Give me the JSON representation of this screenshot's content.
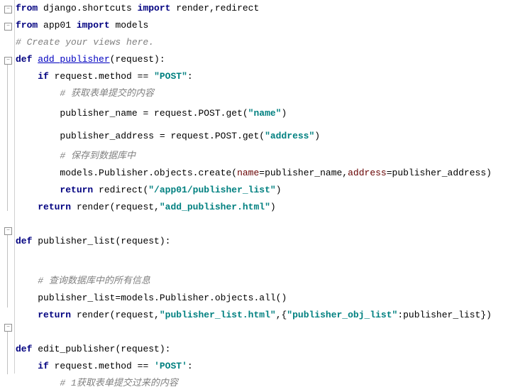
{
  "code": {
    "l1": {
      "kw1": "from",
      "mod1": " django.shortcuts ",
      "kw2": "import",
      "rest": " render,redirect"
    },
    "l2": {
      "kw1": "from",
      "mod1": " app01 ",
      "kw2": "import",
      "rest": " models"
    },
    "l3": {
      "comment": "# Create your views here."
    },
    "l4": {
      "kw1": "def",
      "sp": " ",
      "fn": "add_publisher",
      "rest": "(request):"
    },
    "l5": {
      "indent": "    ",
      "kw1": "if",
      "rest": " request.method == ",
      "str": "\"POST\"",
      "colon": ":"
    },
    "l6": {
      "indent": "        ",
      "comment": "# 获取表单提交的内容"
    },
    "l7": {
      "indent": "        ",
      "a": "publisher_name = request.POST.get(",
      "str": "\"name\"",
      "b": ")"
    },
    "l8": {
      "indent": "        ",
      "a": "publisher_address = request.POST.get(",
      "str": "\"address\"",
      "b": ")"
    },
    "l9": {
      "indent": "        ",
      "comment": "# 保存到数据库中"
    },
    "l10": {
      "indent": "        ",
      "a": "models.Publisher.objects.create(",
      "k1": "name",
      "eq1": "=publisher_name,",
      "k2": "address",
      "eq2": "=publisher_address)"
    },
    "l11": {
      "indent": "        ",
      "kw1": "return",
      "rest": " redirect(",
      "str": "\"/app01/publisher_list\"",
      "b": ")"
    },
    "l12": {
      "indent": "    ",
      "kw1": "return",
      "rest": " render(request,",
      "str": "\"add_publisher.html\"",
      "b": ")"
    },
    "l14": {
      "kw1": "def",
      "sp": " ",
      "fn": "publisher_list",
      "rest": "(request):"
    },
    "l16": {
      "indent": "    ",
      "comment": "# 查询数据库中的所有信息"
    },
    "l17": {
      "indent": "    ",
      "a": "publisher_list=models.Publisher.objects.all()"
    },
    "l18": {
      "indent": "    ",
      "kw1": "return",
      "rest": " render(request,",
      "str1": "\"publisher_list.html\"",
      "m": ",{",
      "str2": "\"publisher_obj_list\"",
      "b": ":publisher_list})"
    },
    "l20": {
      "kw1": "def",
      "sp": " ",
      "fn": "edit_publisher",
      "rest": "(request):"
    },
    "l21": {
      "indent": "    ",
      "kw1": "if",
      "rest": " request.method == ",
      "str": "'POST'",
      "colon": ":"
    },
    "l22": {
      "indent": "        ",
      "comment": "# 1获取表单提交过来的内容"
    }
  }
}
